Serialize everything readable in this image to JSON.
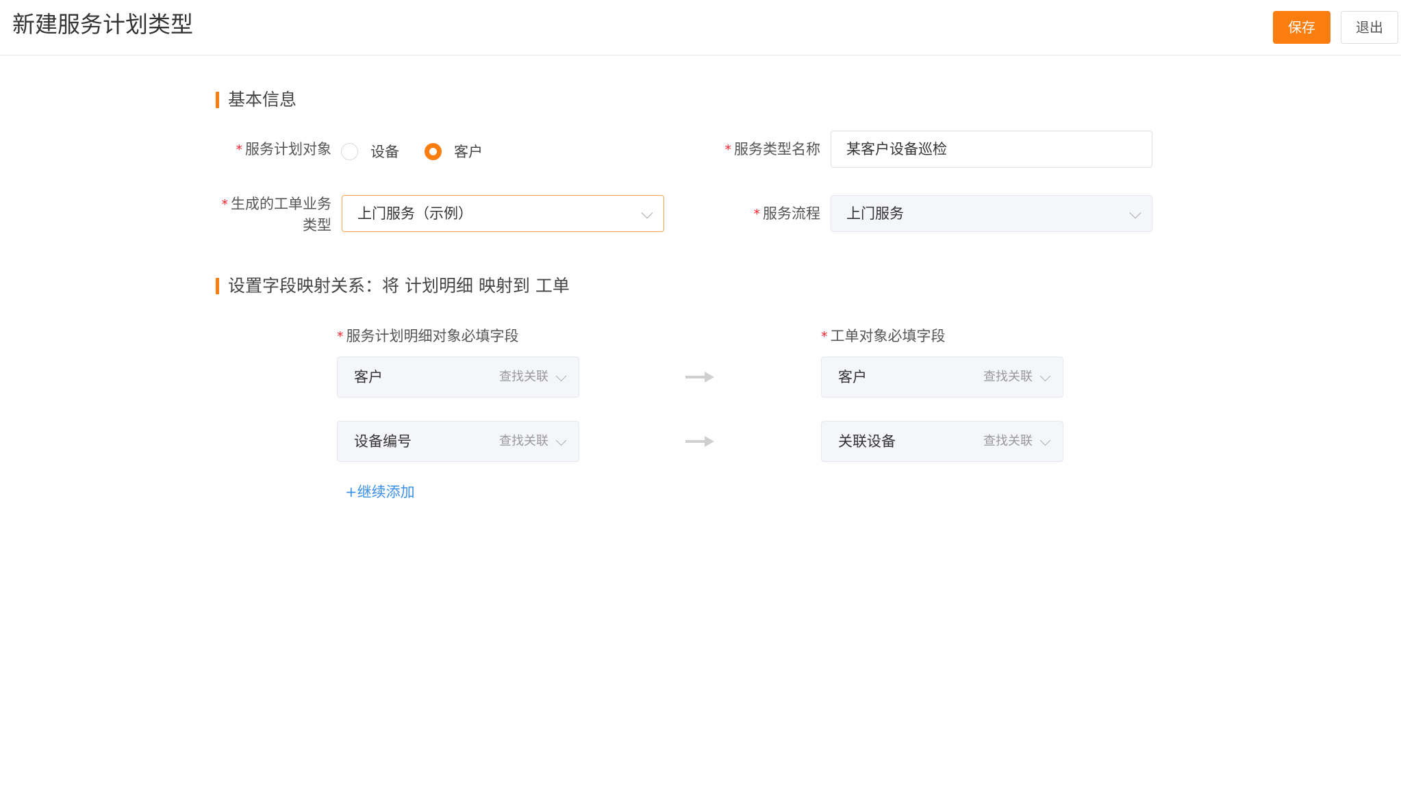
{
  "header": {
    "title": "新建服务计划类型",
    "save_label": "保存",
    "exit_label": "退出"
  },
  "basic_info": {
    "section_title": "基本信息",
    "target": {
      "label": "服务计划对象",
      "options": [
        "设备",
        "客户"
      ],
      "selected": "客户"
    },
    "type_name": {
      "label": "服务类型名称",
      "value": "某客户设备巡检"
    },
    "work_order_type": {
      "label_line1": "生成的工单业务",
      "label_line2": "类型",
      "value": "上门服务（示例）"
    },
    "service_flow": {
      "label": "服务流程",
      "value": "上门服务"
    }
  },
  "mapping": {
    "section_title": "设置字段映射关系：将 计划明细 映射到 工单",
    "left_label": "服务计划明细对象必填字段",
    "right_label": "工单对象必填字段",
    "find_label": "查找关联",
    "rows": [
      {
        "source": "客户",
        "target": "客户"
      },
      {
        "source": "设备编号",
        "target": "关联设备"
      }
    ],
    "add_label": "+继续添加"
  },
  "colors": {
    "accent": "#fa7d0f",
    "link": "#3b8fe8",
    "required": "#f5222d"
  }
}
